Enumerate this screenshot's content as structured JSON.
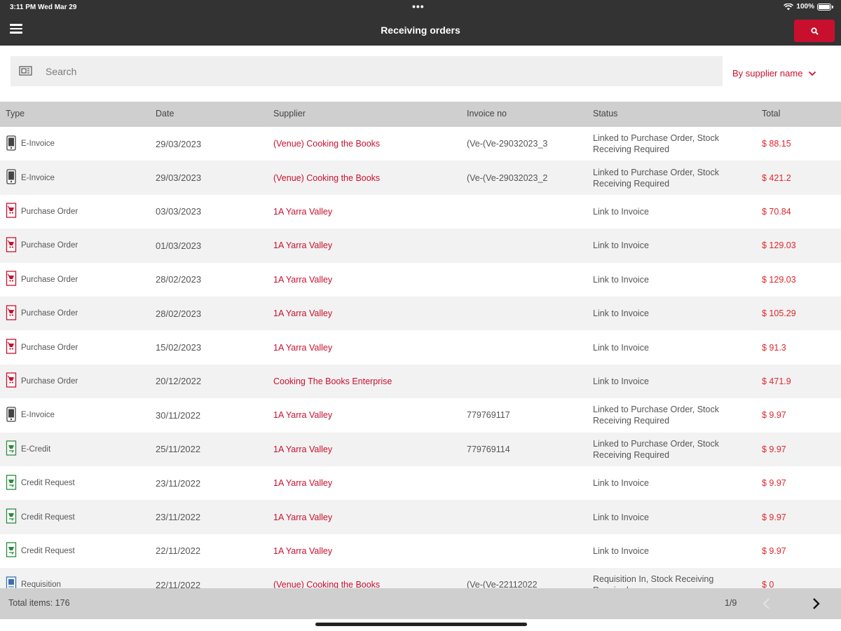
{
  "status_bar": {
    "time": "3:11 PM   Wed Mar 29",
    "battery": "100%"
  },
  "header": {
    "title": "Receiving orders",
    "menu_icon": "hamburger-icon",
    "search_icon": "search-icon",
    "accent": "#c8102e"
  },
  "search": {
    "placeholder": "Search",
    "value": "",
    "sort_label": "By supplier name"
  },
  "table": {
    "columns": [
      "Type",
      "Date",
      "Supplier",
      "Invoice no",
      "Status",
      "Total"
    ],
    "rows": [
      {
        "type": "E-Invoice",
        "icon": "e-invoice-icon",
        "date": "29/03/2023",
        "supplier": "(Venue) Cooking the Books",
        "invoice": "(Ve-(Ve-29032023_3",
        "status": "Linked to Purchase Order, Stock Receiving Required",
        "total": "$ 88.15"
      },
      {
        "type": "E-Invoice",
        "icon": "e-invoice-icon",
        "date": "29/03/2023",
        "supplier": "(Venue) Cooking the Books",
        "invoice": "(Ve-(Ve-29032023_2",
        "status": "Linked to Purchase Order, Stock Receiving Required",
        "total": "$ 421.2"
      },
      {
        "type": "Purchase Order",
        "icon": "purchase-order-icon",
        "date": "03/03/2023",
        "supplier": "1A Yarra Valley",
        "invoice": "",
        "status": "Link to Invoice",
        "total": "$ 70.84"
      },
      {
        "type": "Purchase Order",
        "icon": "purchase-order-icon",
        "date": "01/03/2023",
        "supplier": "1A Yarra Valley",
        "invoice": "",
        "status": "Link to Invoice",
        "total": "$ 129.03"
      },
      {
        "type": "Purchase Order",
        "icon": "purchase-order-icon",
        "date": "28/02/2023",
        "supplier": "1A Yarra Valley",
        "invoice": "",
        "status": "Link to Invoice",
        "total": "$ 129.03"
      },
      {
        "type": "Purchase Order",
        "icon": "purchase-order-icon",
        "date": "28/02/2023",
        "supplier": "1A Yarra Valley",
        "invoice": "",
        "status": "Link to Invoice",
        "total": "$ 105.29"
      },
      {
        "type": "Purchase Order",
        "icon": "purchase-order-icon",
        "date": "15/02/2023",
        "supplier": "1A Yarra Valley",
        "invoice": "",
        "status": "Link to Invoice",
        "total": "$ 91.3"
      },
      {
        "type": "Purchase Order",
        "icon": "purchase-order-icon",
        "date": "20/12/2022",
        "supplier": "Cooking The Books Enterprise",
        "invoice": "",
        "status": "Link to Invoice",
        "total": "$ 471.9"
      },
      {
        "type": "E-Invoice",
        "icon": "e-invoice-icon",
        "date": "30/11/2022",
        "supplier": "1A Yarra Valley",
        "invoice": "779769117",
        "status": "Linked to Purchase Order, Stock Receiving Required",
        "total": "$ 9.97"
      },
      {
        "type": "E-Credit",
        "icon": "e-credit-icon",
        "date": "25/11/2022",
        "supplier": "1A Yarra Valley",
        "invoice": "779769114",
        "status": "Linked to Purchase Order, Stock Receiving Required",
        "total": "$ 9.97"
      },
      {
        "type": "Credit Request",
        "icon": "credit-request-icon",
        "date": "23/11/2022",
        "supplier": "1A Yarra Valley",
        "invoice": "",
        "status": "Link to Invoice",
        "total": "$ 9.97"
      },
      {
        "type": "Credit Request",
        "icon": "credit-request-icon",
        "date": "23/11/2022",
        "supplier": "1A Yarra Valley",
        "invoice": "",
        "status": "Link to Invoice",
        "total": "$ 9.97"
      },
      {
        "type": "Credit Request",
        "icon": "credit-request-icon",
        "date": "22/11/2022",
        "supplier": "1A Yarra Valley",
        "invoice": "",
        "status": "Link to Invoice",
        "total": "$ 9.97"
      },
      {
        "type": "Requisition",
        "icon": "requisition-icon",
        "date": "22/11/2022",
        "supplier": "(Venue) Cooking the Books",
        "invoice": "(Ve-(Ve-22112022",
        "status": "Requisition In, Stock Receiving Required",
        "total": "$ 0"
      }
    ]
  },
  "footer": {
    "total_items": "Total items: 176",
    "page": "1/9"
  }
}
